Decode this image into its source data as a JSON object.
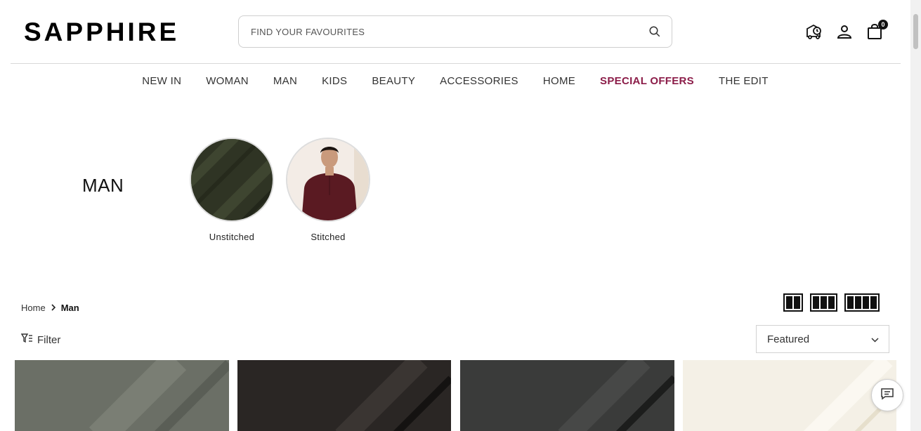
{
  "header": {
    "logo": "SAPPHIRE",
    "search_placeholder": "FIND YOUR FAVOURITES",
    "cart_count": "0"
  },
  "nav": {
    "items": [
      "NEW IN",
      "WOMAN",
      "MAN",
      "KIDS",
      "BEAUTY",
      "ACCESSORIES",
      "HOME",
      "SPECIAL OFFERS",
      "THE EDIT"
    ]
  },
  "category": {
    "title": "MAN",
    "cards": [
      {
        "label": "Unstitched"
      },
      {
        "label": "Stitched"
      }
    ]
  },
  "breadcrumb": {
    "home": "Home",
    "current": "Man"
  },
  "toolbar": {
    "filter_label": "Filter",
    "sort_value": "Featured"
  },
  "colors": {
    "special_offers": "#8b1c48",
    "product_1": "#6b6f66",
    "product_2": "#2a2624",
    "product_3": "#3a3b3a",
    "product_4": "#f4f0e6"
  }
}
